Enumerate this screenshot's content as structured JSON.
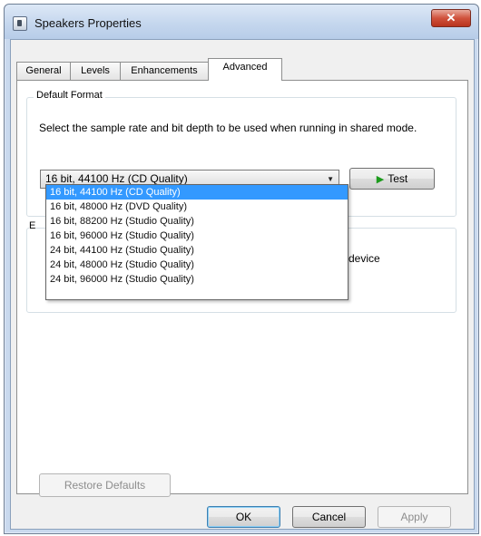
{
  "window": {
    "title": "Speakers Properties",
    "close_label": "x"
  },
  "tabs": [
    {
      "label": "General",
      "active": false
    },
    {
      "label": "Levels",
      "active": false
    },
    {
      "label": "Enhancements",
      "active": false
    },
    {
      "label": "Advanced",
      "active": true
    }
  ],
  "default_format": {
    "legend": "Default Format",
    "description": "Select the sample rate and bit depth to be used when running in shared mode.",
    "selected": "16 bit, 44100 Hz (CD Quality)",
    "test_label": "Test",
    "options": [
      "16 bit, 44100 Hz (CD Quality)",
      "16 bit, 48000 Hz (DVD Quality)",
      "16 bit, 88200 Hz (Studio Quality)",
      "16 bit, 96000 Hz (Studio Quality)",
      "24 bit, 44100 Hz (Studio Quality)",
      "24 bit, 48000 Hz (Studio Quality)",
      "24 bit, 96000 Hz (Studio Quality)"
    ]
  },
  "exclusive": {
    "legend_fragment": "E",
    "text_fragment": "this device"
  },
  "buttons": {
    "restore": "Restore Defaults",
    "ok": "OK",
    "cancel": "Cancel",
    "apply": "Apply"
  },
  "icons": {
    "play": "play-icon",
    "dropdown": "chevron-down-icon",
    "app": "speaker-icon",
    "close": "close-icon"
  }
}
